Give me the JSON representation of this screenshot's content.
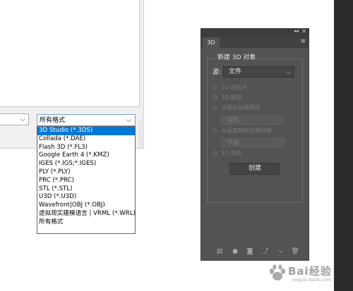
{
  "import_dialog": {
    "format_combo": {
      "value": "所有格式"
    },
    "format_options": [
      "3D Studio (*.3DS)",
      "Collada (*.DAE)",
      "Flash 3D (*.FL3)",
      "Google Earth 4 (*.KMZ)",
      "IGES (*.IGS;*.IGES)",
      "PLY (*.PLY)",
      "PRC (*.PRC)",
      "STL (*.STL)",
      "U3D (*.U3D)",
      "Wavefront|OBJ (*.OBJ)",
      "虚拟现实建模语言 | VRML (*.WRL)",
      "所有格式"
    ],
    "selected_index": 0
  },
  "panel_3d": {
    "tab_label": "3D",
    "group_title": "新建 3D 对象",
    "source_label": "源:",
    "source_value": "文件",
    "options": [
      "3D 明信片",
      "3D 模型",
      "从预设创建网格",
      "从深度映射创建网格",
      "3D 体积"
    ],
    "preset_value": "帽形",
    "depth_value": "平面",
    "create_button": "创建"
  },
  "watermark": {
    "text": "Bai经验",
    "sub": "jingyan.baidu.com"
  },
  "colors": {
    "panel_bg": "#535353",
    "selection": "#0078d7"
  }
}
